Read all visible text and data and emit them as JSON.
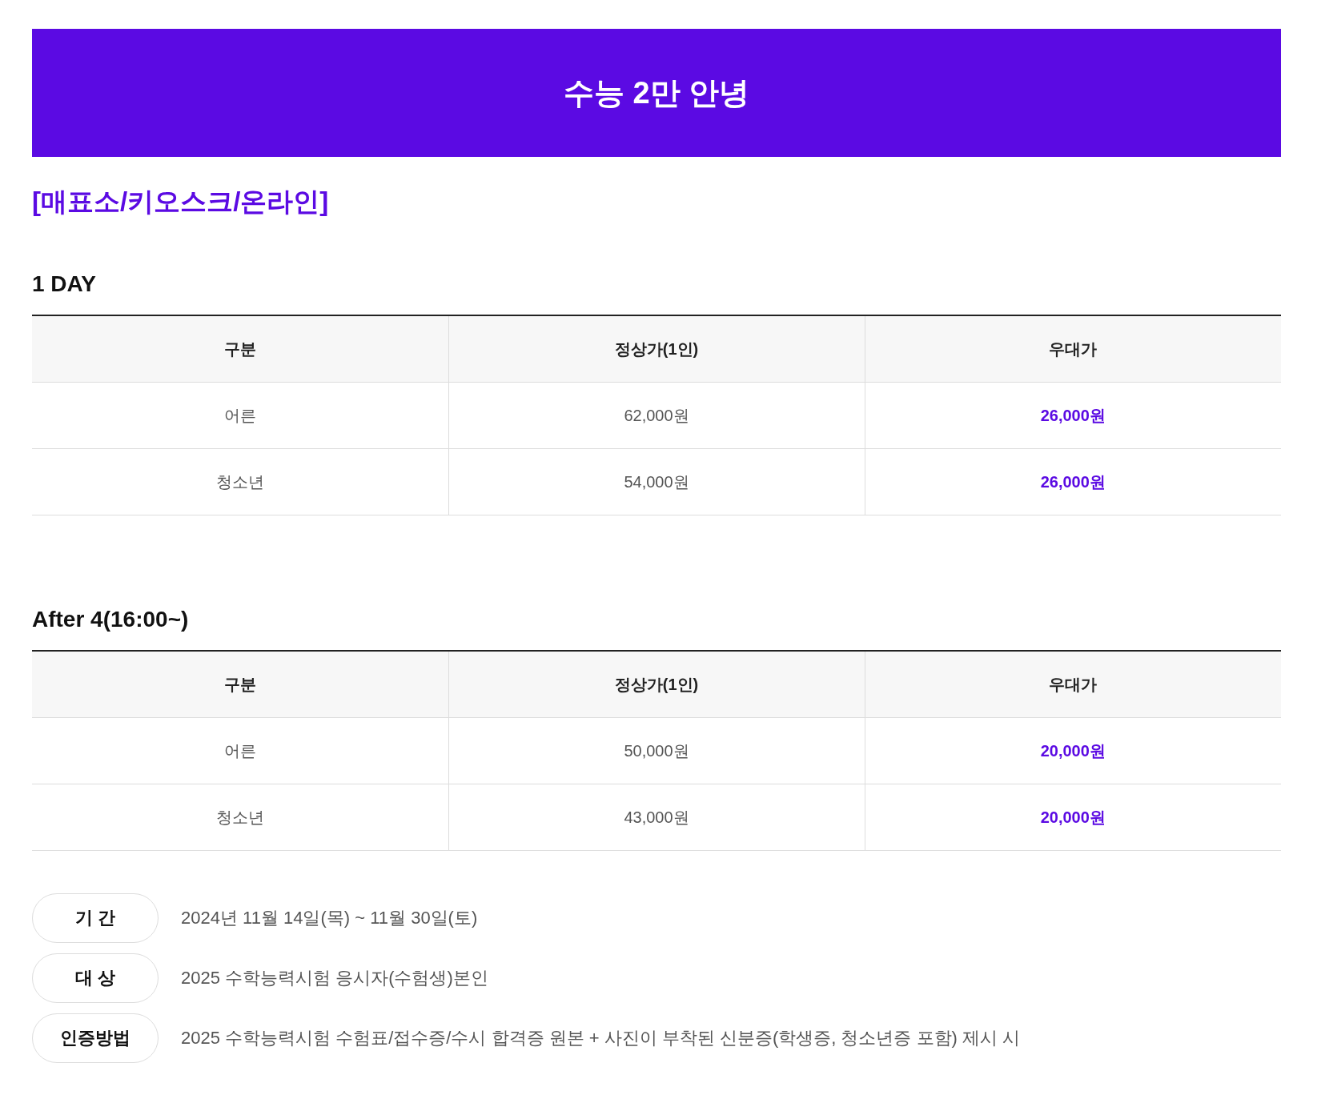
{
  "banner": {
    "title": "수능 2만 안녕"
  },
  "channel_heading": "[매표소/키오스크/온라인]",
  "sections": [
    {
      "title": "1 DAY",
      "columns": [
        "구분",
        "정상가(1인)",
        "우대가"
      ],
      "rows": [
        {
          "type": "어른",
          "regular": "62,000원",
          "discount": "26,000원"
        },
        {
          "type": "청소년",
          "regular": "54,000원",
          "discount": "26,000원"
        }
      ]
    },
    {
      "title": "After 4(16:00~)",
      "columns": [
        "구분",
        "정상가(1인)",
        "우대가"
      ],
      "rows": [
        {
          "type": "어른",
          "regular": "50,000원",
          "discount": "20,000원"
        },
        {
          "type": "청소년",
          "regular": "43,000원",
          "discount": "20,000원"
        }
      ]
    }
  ],
  "info": [
    {
      "label": "기 간",
      "text": "2024년 11월 14일(목) ~ 11월 30일(토)"
    },
    {
      "label": "대 상",
      "text": "2025 수학능력시험 응시자(수험생)본인"
    },
    {
      "label": "인증방법",
      "text": "2025 수학능력시험 수험표/접수증/수시 합격증 원본 + 사진이 부착된 신분증(학생증, 청소년증 포함) 제시 시"
    }
  ]
}
